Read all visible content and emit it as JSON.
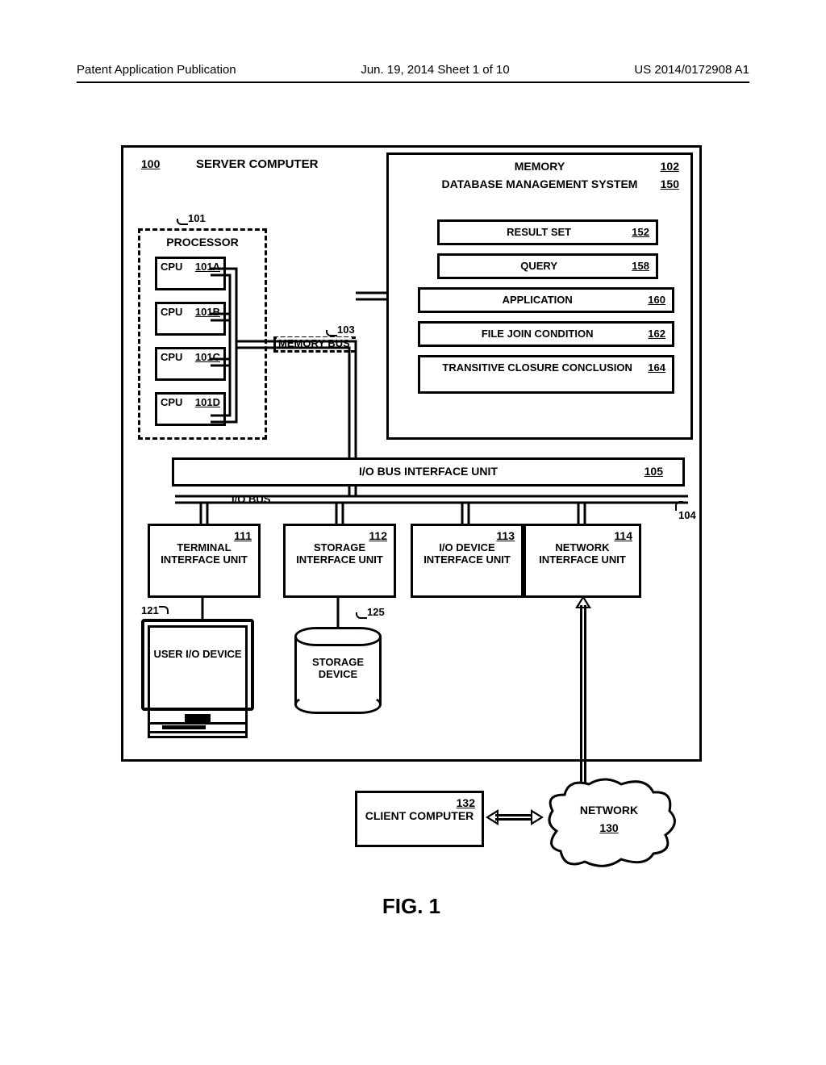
{
  "header": {
    "left": "Patent Application Publication",
    "center": "Jun. 19, 2014  Sheet 1 of 10",
    "right": "US 2014/0172908 A1"
  },
  "figure_label": "FIG. 1",
  "refs": {
    "server": "100",
    "processor": "101",
    "cpuA": "101A",
    "cpuB": "101B",
    "cpuC": "101C",
    "cpuD": "101D",
    "memory": "102",
    "memory_bus": "103",
    "io_bus": "104",
    "io_bus_if": "105",
    "term_if": "111",
    "storage_if": "112",
    "iodev_if": "113",
    "net_if": "114",
    "user_io": "121",
    "storage_dev": "125",
    "network": "130",
    "client": "132",
    "dbms": "150",
    "result_set": "152",
    "query": "158",
    "application": "160",
    "file_join": "162",
    "transitive": "164"
  },
  "labels": {
    "server": "SERVER COMPUTER",
    "processor": "PROCESSOR",
    "cpu": "CPU",
    "memory_bus": "MEMORY BUS",
    "memory": "MEMORY",
    "dbms": "DATABASE MANAGEMENT SYSTEM",
    "result_set": "RESULT SET",
    "query": "QUERY",
    "application": "APPLICATION",
    "file_join": "FILE JOIN CONDITION",
    "transitive": "TRANSITIVE CLOSURE CONCLUSION",
    "io_bus_if": "I/O BUS INTERFACE UNIT",
    "io_bus": "I/O BUS",
    "term_if": "TERMINAL INTERFACE UNIT",
    "storage_if": "STORAGE INTERFACE UNIT",
    "iodev_if": "I/O DEVICE INTERFACE UNIT",
    "net_if": "NETWORK INTERFACE UNIT",
    "user_io": "USER I/O DEVICE",
    "storage_dev": "STORAGE DEVICE",
    "client": "CLIENT COMPUTER",
    "network": "NETWORK"
  }
}
